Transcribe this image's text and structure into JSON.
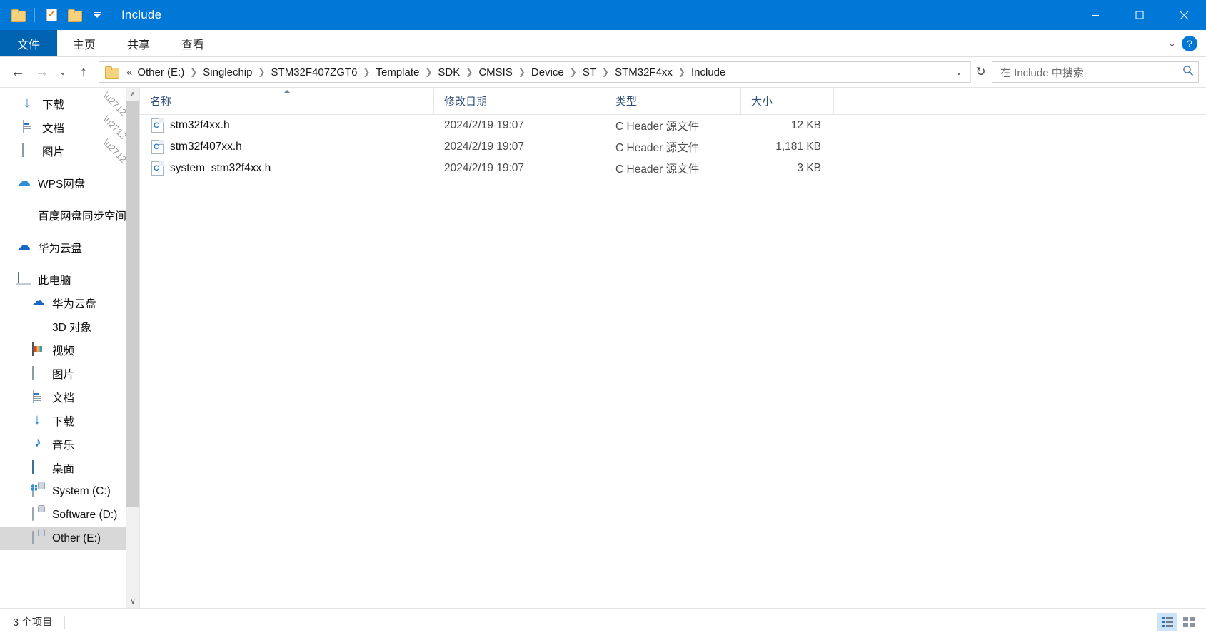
{
  "titlebar": {
    "title": "Include",
    "quick_access": [
      {
        "name": "folder-icon",
        "label": "Folder"
      },
      {
        "name": "properties-icon",
        "label": "Properties"
      },
      {
        "name": "new-folder-icon",
        "label": "New folder"
      },
      {
        "name": "customize-qat-icon",
        "label": "Customize Quick Access Toolbar"
      }
    ],
    "minimize": "─",
    "maximize": "☐",
    "close": "✕"
  },
  "ribbon": {
    "file_tab": "文件",
    "tabs": [
      "主页",
      "共享",
      "查看"
    ],
    "expand": "⌄",
    "help": "?"
  },
  "address": {
    "back": "←",
    "forward": "→",
    "recent": "⌄",
    "up": "↑",
    "root_prefix": "«",
    "crumbs": [
      "Other (E:)",
      "Singlechip",
      "STM32F407ZGT6",
      "Template",
      "SDK",
      "CMSIS",
      "Device",
      "ST",
      "STM32F4xx",
      "Include"
    ],
    "separator": "❯",
    "dropdown": "⌄",
    "refresh": "↻"
  },
  "search": {
    "placeholder": "在 Include 中搜索",
    "icon": "⚲"
  },
  "sidebar": {
    "scroll_up": "∧",
    "scroll_down": "∨",
    "groups": [
      {
        "items": [
          {
            "label": "下载",
            "icon": "download-icon",
            "pinned": true,
            "level": 1
          },
          {
            "label": "文档",
            "icon": "documents-icon",
            "pinned": true,
            "level": 1
          },
          {
            "label": "图片",
            "icon": "pictures-icon",
            "pinned": true,
            "level": 1
          }
        ]
      },
      {
        "items": [
          {
            "label": "WPS网盘",
            "icon": "wps-cloud-icon",
            "pinned": false,
            "level": 0
          }
        ]
      },
      {
        "items": [
          {
            "label": "百度网盘同步空间",
            "icon": "baidu-netdisk-icon",
            "pinned": false,
            "level": 0
          }
        ]
      },
      {
        "items": [
          {
            "label": "华为云盘",
            "icon": "huawei-cloud-icon",
            "pinned": false,
            "level": 0
          }
        ]
      },
      {
        "items": [
          {
            "label": "此电脑",
            "icon": "this-pc-icon",
            "pinned": false,
            "level": 0
          },
          {
            "label": "华为云盘",
            "icon": "huawei-cloud-icon",
            "pinned": false,
            "level": 1
          },
          {
            "label": "3D 对象",
            "icon": "3d-objects-icon",
            "pinned": false,
            "level": 1
          },
          {
            "label": "视频",
            "icon": "videos-icon",
            "pinned": false,
            "level": 1
          },
          {
            "label": "图片",
            "icon": "pictures-icon",
            "pinned": false,
            "level": 1
          },
          {
            "label": "文档",
            "icon": "documents-icon",
            "pinned": false,
            "level": 1
          },
          {
            "label": "下载",
            "icon": "download-icon",
            "pinned": false,
            "level": 1
          },
          {
            "label": "音乐",
            "icon": "music-icon",
            "pinned": false,
            "level": 1
          },
          {
            "label": "桌面",
            "icon": "desktop-icon",
            "pinned": false,
            "level": 1
          },
          {
            "label": "System (C:)",
            "icon": "system-drive-icon",
            "pinned": false,
            "level": 1
          },
          {
            "label": "Software (D:)",
            "icon": "drive-icon",
            "pinned": false,
            "level": 1
          },
          {
            "label": "Other (E:)",
            "icon": "drive-icon",
            "pinned": false,
            "level": 1,
            "selected": true
          }
        ]
      }
    ]
  },
  "columns": [
    {
      "label": "名称",
      "key": "name",
      "sorted": "asc"
    },
    {
      "label": "修改日期",
      "key": "date",
      "sorted": null
    },
    {
      "label": "类型",
      "key": "type",
      "sorted": null
    },
    {
      "label": "大小",
      "key": "size",
      "sorted": null
    }
  ],
  "files": [
    {
      "name": "stm32f4xx.h",
      "date": "2024/2/19 19:07",
      "type": "C Header 源文件",
      "size": "12 KB",
      "icon": "c-header-file-icon"
    },
    {
      "name": "stm32f407xx.h",
      "date": "2024/2/19 19:07",
      "type": "C Header 源文件",
      "size": "1,181 KB",
      "icon": "c-header-file-icon"
    },
    {
      "name": "system_stm32f4xx.h",
      "date": "2024/2/19 19:07",
      "type": "C Header 源文件",
      "size": "3 KB",
      "icon": "c-header-file-icon"
    }
  ],
  "statusbar": {
    "item_count": "3 个项目",
    "views": [
      {
        "name": "details-view-button",
        "active": true
      },
      {
        "name": "large-icons-view-button",
        "active": false
      }
    ]
  },
  "colors": {
    "titlebar": "#0078d7",
    "file_tab": "#0063b1",
    "selection": "#d8d8d8",
    "hover": "#e5f3fd",
    "column_header_text": "#2f4f7a"
  }
}
